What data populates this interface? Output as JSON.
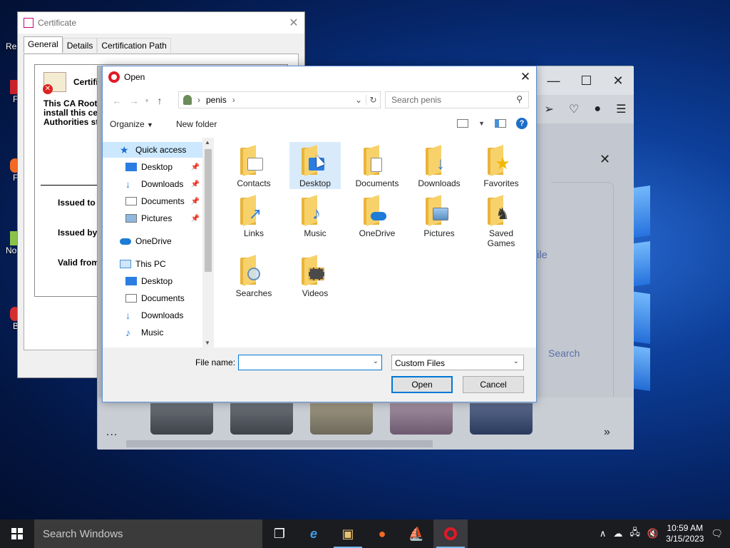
{
  "desktop": {
    "icon_labels": [
      "Re",
      "F",
      "F",
      "No",
      "B"
    ]
  },
  "cert_window": {
    "title": "Certificate",
    "tabs": [
      "General",
      "Details",
      "Certification Path"
    ],
    "heading": "Certific",
    "body_lines": [
      "This CA Root c",
      "install this cer",
      "Authorities st"
    ],
    "fields": [
      "Issued to",
      "Issued by",
      "Valid from"
    ]
  },
  "browser": {
    "file_hint": "ile",
    "search_label": "Search",
    "menu_dots": "...",
    "more": "»"
  },
  "dialog": {
    "title": "Open",
    "breadcrumb": {
      "folder": "penis"
    },
    "search_placeholder": "Search penis",
    "organize_label": "Organize",
    "new_folder_label": "New folder",
    "nav": {
      "quick_access": "Quick access",
      "quick_items": [
        "Desktop",
        "Downloads",
        "Documents",
        "Pictures"
      ],
      "onedrive": "OneDrive",
      "this_pc": "This PC",
      "pc_items": [
        "Desktop",
        "Documents",
        "Downloads",
        "Music"
      ]
    },
    "files": [
      {
        "name": "Contacts",
        "emblem": "contacts-card"
      },
      {
        "name": "Desktop",
        "emblem": "desktop-screen",
        "selected": true
      },
      {
        "name": "Documents",
        "emblem": "document-page"
      },
      {
        "name": "Downloads",
        "emblem": "down-arrow"
      },
      {
        "name": "Favorites",
        "emblem": "star"
      },
      {
        "name": "Links",
        "emblem": "shortcut-arrow"
      },
      {
        "name": "Music",
        "emblem": "music-note"
      },
      {
        "name": "OneDrive",
        "emblem": "cloud"
      },
      {
        "name": "Pictures",
        "emblem": "landscape-photo"
      },
      {
        "name": "Saved Games",
        "emblem": "chess-piece"
      },
      {
        "name": "Searches",
        "emblem": "magnifier"
      },
      {
        "name": "Videos",
        "emblem": "film-strip"
      }
    ],
    "file_name_label": "File name:",
    "file_name_value": "",
    "file_type": "Custom Files",
    "open_label": "Open",
    "cancel_label": "Cancel"
  },
  "taskbar": {
    "search_placeholder": "Search Windows",
    "time": "10:59 AM",
    "date": "3/15/2023"
  },
  "colors": {
    "accent": "#0078d7",
    "selection": "#cce8ff",
    "folder": "#f7d26b",
    "opera_red": "#e21927"
  }
}
